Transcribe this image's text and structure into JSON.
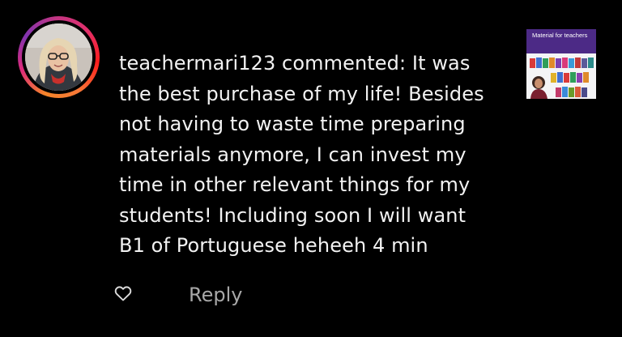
{
  "comment": {
    "username": "teachermari123",
    "lines": [
      "teachermari123 commented: It was",
      "the best purchase of my life! Besides",
      "not having to waste time preparing",
      "materials anymore, I can invest my",
      "time in other relevant things for my",
      "students! Including soon I will want",
      "B1 of Portuguese heheeh 4 min"
    ],
    "time": "4 min"
  },
  "post_thumbnail": {
    "title": "Material for teachers"
  },
  "actions": {
    "like_icon": "heart-outline-icon",
    "reply_label": "Reply"
  },
  "colors": {
    "background": "#000000",
    "text": "#f2f2f2",
    "secondary_text": "#a8a8a8",
    "thumb_header": "#4c2a86"
  }
}
